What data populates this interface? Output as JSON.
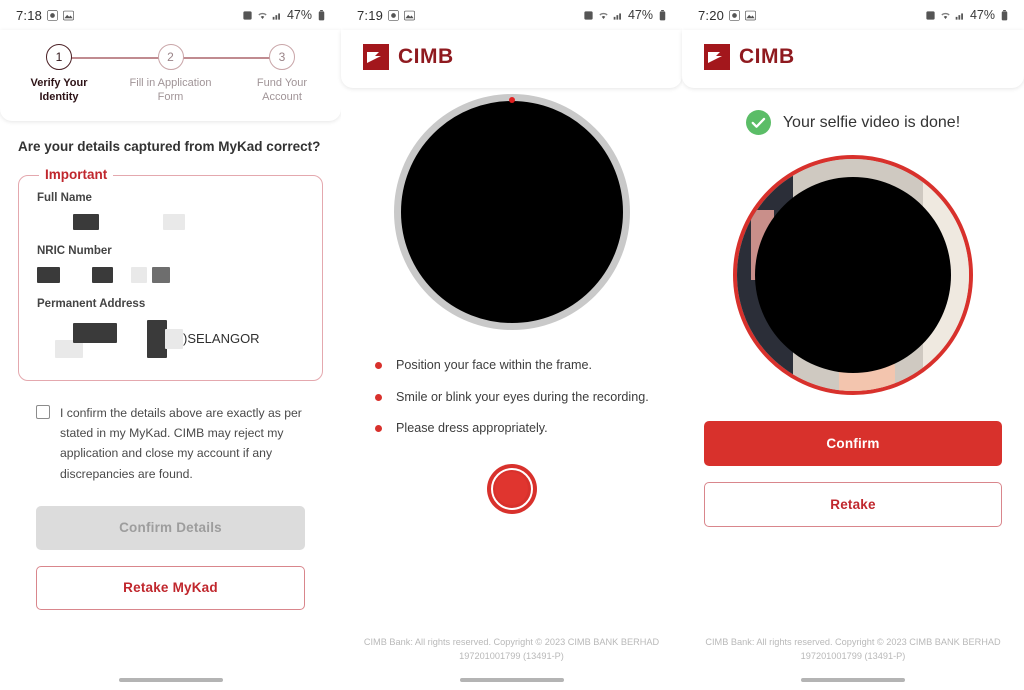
{
  "panels": [
    {
      "statusbar": {
        "time": "7:18",
        "left_icons": [
          "camera-icon",
          "gallery-icon"
        ],
        "right_icons": [
          "alarm-icon",
          "wifi-icon",
          "signal-icon"
        ],
        "battery": "47%"
      },
      "stepper": {
        "steps": [
          {
            "number": "1",
            "label": "Verify Your Identity",
            "active": true
          },
          {
            "number": "2",
            "label": "Fill in Application Form",
            "active": false
          },
          {
            "number": "3",
            "label": "Fund Your Account",
            "active": false
          }
        ]
      },
      "question": "Are your details captured from MyKad correct?",
      "fieldset": {
        "legend": "Important",
        "fields": [
          {
            "label": "Full Name",
            "value_redacted": true
          },
          {
            "label": "NRIC Number",
            "value_redacted": true
          },
          {
            "label": "Permanent Address",
            "value_visible": ")SELANGOR"
          }
        ]
      },
      "confirm_checkbox": {
        "checked": false,
        "text": "I confirm the details above are exactly as per stated in my MyKad. CIMB may reject my application and close my account if any discrepancies are found."
      },
      "buttons": {
        "primary": "Confirm Details",
        "primary_disabled": true,
        "secondary": "Retake MyKad"
      }
    },
    {
      "statusbar": {
        "time": "7:19",
        "battery": "47%"
      },
      "brand": "CIMB",
      "camera": {
        "recording_dot": true
      },
      "instructions": [
        "Position your face within the frame.",
        "Smile or blink your eyes during the recording.",
        "Please dress appropriately."
      ],
      "record_button_label": "record-button",
      "footer": "CIMB Bank: All rights reserved. Copyright © 2023 CIMB BANK BERHAD 197201001799 (13491-P)"
    },
    {
      "statusbar": {
        "time": "7:20",
        "battery": "47%"
      },
      "brand": "CIMB",
      "success_message": "Your selfie video is done!",
      "buttons": {
        "primary": "Confirm",
        "secondary": "Retake"
      },
      "footer": "CIMB Bank: All rights reserved. Copyright © 2023 CIMB BANK BERHAD 197201001799 (13491-P)"
    }
  ],
  "colors": {
    "brand_red": "#d8312c",
    "brand_dark_red": "#8f1a1f",
    "accent_pink": "#e4a8ae",
    "success_green": "#5bbd67"
  }
}
